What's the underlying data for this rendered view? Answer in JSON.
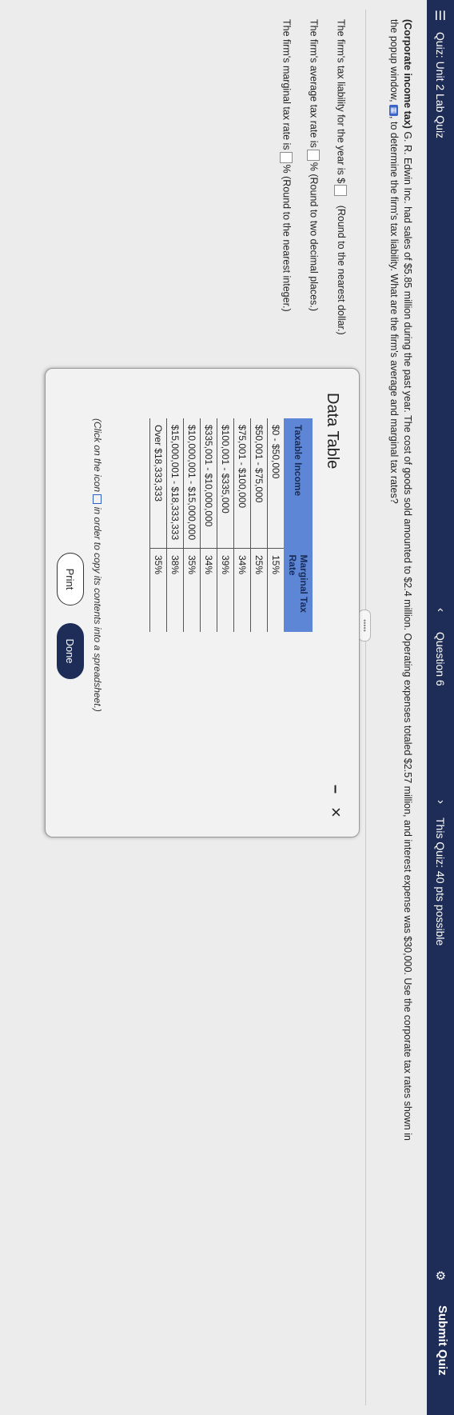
{
  "topbar": {
    "quiz_title": "Quiz: Unit 2 Lab Quiz",
    "question_label": "Question 6",
    "points": "This Quiz: 40 pts possible",
    "submit_label": "Submit Quiz"
  },
  "question": {
    "bold_prefix": "(Corporate income tax)",
    "text_1": " G. R. Edwin Inc. had sales of $5.85 million during the past year. The cost of goods sold amounted to $2.4 million. Operating expenses totaled $2.57 million, and interest expense was $30,000. Use the corporate tax rates shown in",
    "text_2": "the popup window,",
    "text_3": ", to determine the firm's tax liability. What are the firm's average and marginal tax rates?"
  },
  "answers": {
    "liability_prefix": "The firm's tax liability for the year is $",
    "liability_hint": "(Round to the nearest dollar.)",
    "average_prefix": "The firm's average tax rate is",
    "average_hint": "% (Round to two decimal places.)",
    "marginal_prefix": "The firm's marginal tax rate is",
    "marginal_hint": "% (Round to the nearest integer.)"
  },
  "modal": {
    "title": "Data Table",
    "minimize_symbol": "–",
    "close_symbol": "×",
    "headers": [
      "Taxable Income",
      "Marginal Tax Rate"
    ],
    "rows": [
      {
        "range": "$0 - $50,000",
        "rate": "15%"
      },
      {
        "range": "$50,001 - $75,000",
        "rate": "25%"
      },
      {
        "range": "$75,001 - $100,000",
        "rate": "34%"
      },
      {
        "range": "$100,001 - $335,000",
        "rate": "39%"
      },
      {
        "range": "$335,001 - $10,000,000",
        "rate": "34%"
      },
      {
        "range": "$10,000,001 - $15,000,000",
        "rate": "35%"
      },
      {
        "range": "$15,000,001 - $18,333,333",
        "rate": "38%"
      },
      {
        "range": "Over $18,333,333",
        "rate": "35%"
      }
    ],
    "note_prefix": "(Click on the icon",
    "note_suffix": "in order to copy its contents into a spreadsheet.)",
    "print_label": "Print",
    "done_label": "Done"
  }
}
